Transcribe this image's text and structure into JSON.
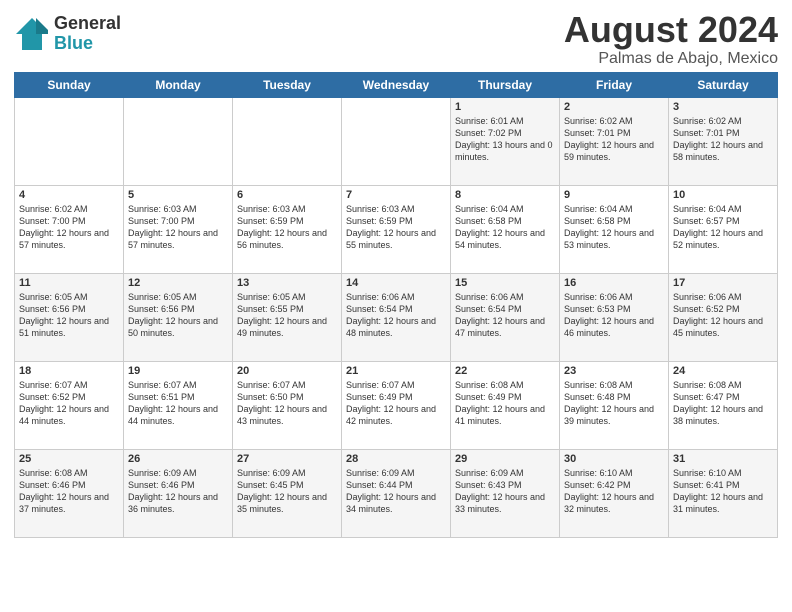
{
  "logo": {
    "line1": "General",
    "line2": "Blue"
  },
  "title": "August 2024",
  "subtitle": "Palmas de Abajo, Mexico",
  "days_of_week": [
    "Sunday",
    "Monday",
    "Tuesday",
    "Wednesday",
    "Thursday",
    "Friday",
    "Saturday"
  ],
  "weeks": [
    [
      {
        "day": "",
        "content": ""
      },
      {
        "day": "",
        "content": ""
      },
      {
        "day": "",
        "content": ""
      },
      {
        "day": "",
        "content": ""
      },
      {
        "day": "1",
        "content": "Sunrise: 6:01 AM\nSunset: 7:02 PM\nDaylight: 13 hours\nand 0 minutes."
      },
      {
        "day": "2",
        "content": "Sunrise: 6:02 AM\nSunset: 7:01 PM\nDaylight: 12 hours\nand 59 minutes."
      },
      {
        "day": "3",
        "content": "Sunrise: 6:02 AM\nSunset: 7:01 PM\nDaylight: 12 hours\nand 58 minutes."
      }
    ],
    [
      {
        "day": "4",
        "content": "Sunrise: 6:02 AM\nSunset: 7:00 PM\nDaylight: 12 hours\nand 57 minutes."
      },
      {
        "day": "5",
        "content": "Sunrise: 6:03 AM\nSunset: 7:00 PM\nDaylight: 12 hours\nand 57 minutes."
      },
      {
        "day": "6",
        "content": "Sunrise: 6:03 AM\nSunset: 6:59 PM\nDaylight: 12 hours\nand 56 minutes."
      },
      {
        "day": "7",
        "content": "Sunrise: 6:03 AM\nSunset: 6:59 PM\nDaylight: 12 hours\nand 55 minutes."
      },
      {
        "day": "8",
        "content": "Sunrise: 6:04 AM\nSunset: 6:58 PM\nDaylight: 12 hours\nand 54 minutes."
      },
      {
        "day": "9",
        "content": "Sunrise: 6:04 AM\nSunset: 6:58 PM\nDaylight: 12 hours\nand 53 minutes."
      },
      {
        "day": "10",
        "content": "Sunrise: 6:04 AM\nSunset: 6:57 PM\nDaylight: 12 hours\nand 52 minutes."
      }
    ],
    [
      {
        "day": "11",
        "content": "Sunrise: 6:05 AM\nSunset: 6:56 PM\nDaylight: 12 hours\nand 51 minutes."
      },
      {
        "day": "12",
        "content": "Sunrise: 6:05 AM\nSunset: 6:56 PM\nDaylight: 12 hours\nand 50 minutes."
      },
      {
        "day": "13",
        "content": "Sunrise: 6:05 AM\nSunset: 6:55 PM\nDaylight: 12 hours\nand 49 minutes."
      },
      {
        "day": "14",
        "content": "Sunrise: 6:06 AM\nSunset: 6:54 PM\nDaylight: 12 hours\nand 48 minutes."
      },
      {
        "day": "15",
        "content": "Sunrise: 6:06 AM\nSunset: 6:54 PM\nDaylight: 12 hours\nand 47 minutes."
      },
      {
        "day": "16",
        "content": "Sunrise: 6:06 AM\nSunset: 6:53 PM\nDaylight: 12 hours\nand 46 minutes."
      },
      {
        "day": "17",
        "content": "Sunrise: 6:06 AM\nSunset: 6:52 PM\nDaylight: 12 hours\nand 45 minutes."
      }
    ],
    [
      {
        "day": "18",
        "content": "Sunrise: 6:07 AM\nSunset: 6:52 PM\nDaylight: 12 hours\nand 44 minutes."
      },
      {
        "day": "19",
        "content": "Sunrise: 6:07 AM\nSunset: 6:51 PM\nDaylight: 12 hours\nand 44 minutes."
      },
      {
        "day": "20",
        "content": "Sunrise: 6:07 AM\nSunset: 6:50 PM\nDaylight: 12 hours\nand 43 minutes."
      },
      {
        "day": "21",
        "content": "Sunrise: 6:07 AM\nSunset: 6:49 PM\nDaylight: 12 hours\nand 42 minutes."
      },
      {
        "day": "22",
        "content": "Sunrise: 6:08 AM\nSunset: 6:49 PM\nDaylight: 12 hours\nand 41 minutes."
      },
      {
        "day": "23",
        "content": "Sunrise: 6:08 AM\nSunset: 6:48 PM\nDaylight: 12 hours\nand 39 minutes."
      },
      {
        "day": "24",
        "content": "Sunrise: 6:08 AM\nSunset: 6:47 PM\nDaylight: 12 hours\nand 38 minutes."
      }
    ],
    [
      {
        "day": "25",
        "content": "Sunrise: 6:08 AM\nSunset: 6:46 PM\nDaylight: 12 hours\nand 37 minutes."
      },
      {
        "day": "26",
        "content": "Sunrise: 6:09 AM\nSunset: 6:46 PM\nDaylight: 12 hours\nand 36 minutes."
      },
      {
        "day": "27",
        "content": "Sunrise: 6:09 AM\nSunset: 6:45 PM\nDaylight: 12 hours\nand 35 minutes."
      },
      {
        "day": "28",
        "content": "Sunrise: 6:09 AM\nSunset: 6:44 PM\nDaylight: 12 hours\nand 34 minutes."
      },
      {
        "day": "29",
        "content": "Sunrise: 6:09 AM\nSunset: 6:43 PM\nDaylight: 12 hours\nand 33 minutes."
      },
      {
        "day": "30",
        "content": "Sunrise: 6:10 AM\nSunset: 6:42 PM\nDaylight: 12 hours\nand 32 minutes."
      },
      {
        "day": "31",
        "content": "Sunrise: 6:10 AM\nSunset: 6:41 PM\nDaylight: 12 hours\nand 31 minutes."
      }
    ]
  ]
}
